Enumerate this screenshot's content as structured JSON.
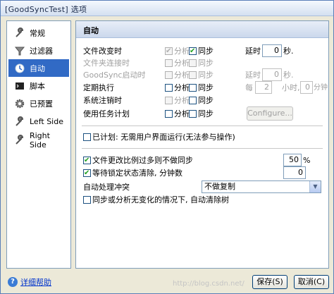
{
  "window": {
    "title": "[GoodSyncTest] 选项"
  },
  "sidebar": {
    "items": [
      {
        "label": "常规",
        "icon": "wrench-icon",
        "selected": false
      },
      {
        "label": "过滤器",
        "icon": "funnel-icon",
        "selected": false
      },
      {
        "label": "自动",
        "icon": "auto-clock-icon",
        "selected": true
      },
      {
        "label": "脚本",
        "icon": "script-icon",
        "selected": false
      },
      {
        "label": "已预置",
        "icon": "gear-icon",
        "selected": false
      },
      {
        "label": "Left Side",
        "icon": "wrench-icon",
        "selected": false
      },
      {
        "label": "Right Side",
        "icon": "wrench-icon",
        "selected": false
      }
    ]
  },
  "panel": {
    "header": "自动",
    "triggers": [
      {
        "label": "文件改变时",
        "enabled": true,
        "analyze_label": "分析",
        "analyze_checked": true,
        "analyze_disabled": true,
        "sync_label": "同步",
        "sync_checked": true,
        "sync_disabled": false,
        "delay_label": "延时",
        "delay_value": "0",
        "delay_unit": "秒."
      },
      {
        "label": "文件夹连接时",
        "enabled": false,
        "analyze_label": "分析",
        "analyze_checked": false,
        "analyze_disabled": true,
        "sync_label": "同步",
        "sync_checked": false,
        "sync_disabled": true
      },
      {
        "label": "GoodSync启动时",
        "enabled": false,
        "analyze_label": "分析",
        "analyze_checked": false,
        "analyze_disabled": true,
        "sync_label": "同步",
        "sync_checked": false,
        "sync_disabled": true,
        "delay_label": "延时",
        "delay_value": "0",
        "delay_unit": "秒."
      },
      {
        "label": "定期执行",
        "enabled": true,
        "analyze_label": "分析",
        "analyze_checked": false,
        "analyze_disabled": false,
        "sync_label": "同步",
        "sync_checked": false,
        "sync_disabled": false,
        "every_label": "每",
        "hours_value": "2",
        "hours_unit": "小时,",
        "minutes_value": "0",
        "minutes_unit": "分钟"
      },
      {
        "label": "系统注销时",
        "enabled": true,
        "analyze_label": "分析",
        "analyze_checked": false,
        "analyze_disabled": true,
        "sync_label": "同步",
        "sync_checked": false,
        "sync_disabled": false
      },
      {
        "label": "使用任务计划",
        "enabled": true,
        "analyze_label": "分析",
        "analyze_checked": false,
        "analyze_disabled": false,
        "sync_label": "同步",
        "sync_checked": false,
        "sync_disabled": false,
        "configure_label": "Configure..."
      }
    ],
    "scheduled_option": {
      "label": "已计划: 无需用户界面运行(无法参与操作)",
      "checked": false
    },
    "options": {
      "stop_if_changed": {
        "label": "文件更改比例过多则不做同步",
        "checked": true,
        "value": "50",
        "unit": "%"
      },
      "wait_lock": {
        "label": "等待锁定状态清除, 分钟数",
        "checked": true,
        "value": "0"
      },
      "conflict": {
        "label": "自动处理冲突",
        "selected": "不做复制"
      },
      "auto_clear": {
        "label": "同步或分析无变化的情况下, 自动清除树",
        "checked": false
      }
    }
  },
  "footer": {
    "help_label": "详细帮助",
    "save_label": "保存(S)",
    "cancel_label": "取消(C)"
  },
  "watermark": "http://blog.csdn.net/"
}
